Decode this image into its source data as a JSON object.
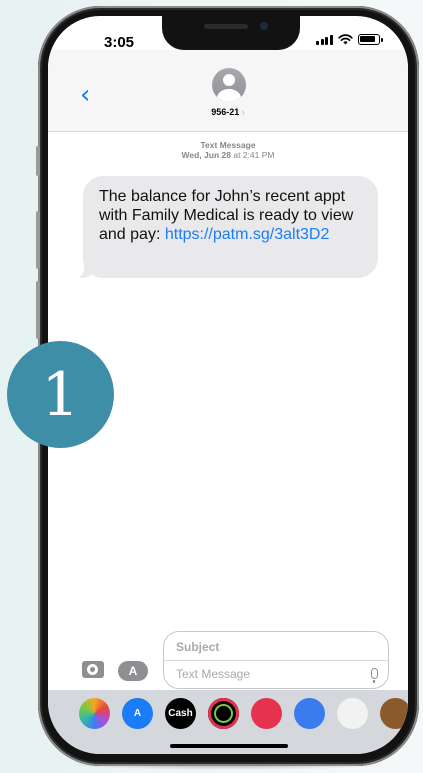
{
  "status_bar": {
    "time": "3:05"
  },
  "header": {
    "back_icon": "chevron-left-icon",
    "contact": "956-21",
    "chevron": "›"
  },
  "conversation": {
    "service": "Text Message",
    "date": "Wed, Jun 28",
    "time_prefix": "at",
    "time": "2:41 PM",
    "message_text": "The balance for John’s recent appt with Family Medical is ready to view and pay:",
    "message_link": "https://patm.sg/3alt3D2"
  },
  "step_badge": {
    "number": "1",
    "color": "#3f8ea8"
  },
  "compose": {
    "subject_placeholder": "Subject",
    "message_placeholder": "Text Message",
    "apps_glyph": "A"
  },
  "app_tray": {
    "apps": [
      {
        "name": "photos-icon",
        "color": "#ffffff",
        "label": ""
      },
      {
        "name": "app-store-icon",
        "color": "#1a7cf6",
        "label": "A"
      },
      {
        "name": "apple-cash-icon",
        "color": "#000000",
        "label": "Cash"
      },
      {
        "name": "activity-icon",
        "color": "#000000",
        "label": ""
      },
      {
        "name": "search-images-icon",
        "color": "#e5324f",
        "label": ""
      },
      {
        "name": "audio-message-icon",
        "color": "#3a7cf0",
        "label": ""
      },
      {
        "name": "memoji-stickers-icon",
        "color": "#f2f2f2",
        "label": ""
      },
      {
        "name": "memoji-icon",
        "color": "#8a5a2b",
        "label": ""
      }
    ]
  },
  "colors": {
    "accent": "#1a7cf6",
    "bubble": "#e9e9eb"
  }
}
